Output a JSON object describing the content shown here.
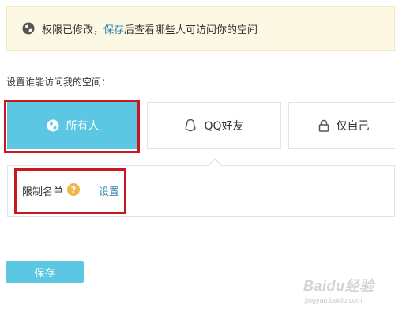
{
  "notice": {
    "prefix": "权限已修改，",
    "link": "保存",
    "suffix": "后查看哪些人可访问你的空间",
    "icon": "globe-icon"
  },
  "section_label": "设置谁能访问我的空间：",
  "options": [
    {
      "label": "所有人",
      "icon": "globe-icon",
      "selected": true
    },
    {
      "label": "QQ好友",
      "icon": "qq-penguin-icon",
      "selected": false
    },
    {
      "label": "仅自己",
      "icon": "lock-icon",
      "selected": false
    }
  ],
  "restriction": {
    "label": "限制名单",
    "help_glyph": "?",
    "link": "设置"
  },
  "save_button": "保存",
  "watermark": {
    "logo": "Baidu经验",
    "url": "jingyan.baidu.com"
  },
  "colors": {
    "accent": "#5bc7e3",
    "link": "#2f7fb0",
    "notice_bg": "#fcf8e3",
    "highlight": "#c9161f",
    "help": "#f0b64a"
  }
}
